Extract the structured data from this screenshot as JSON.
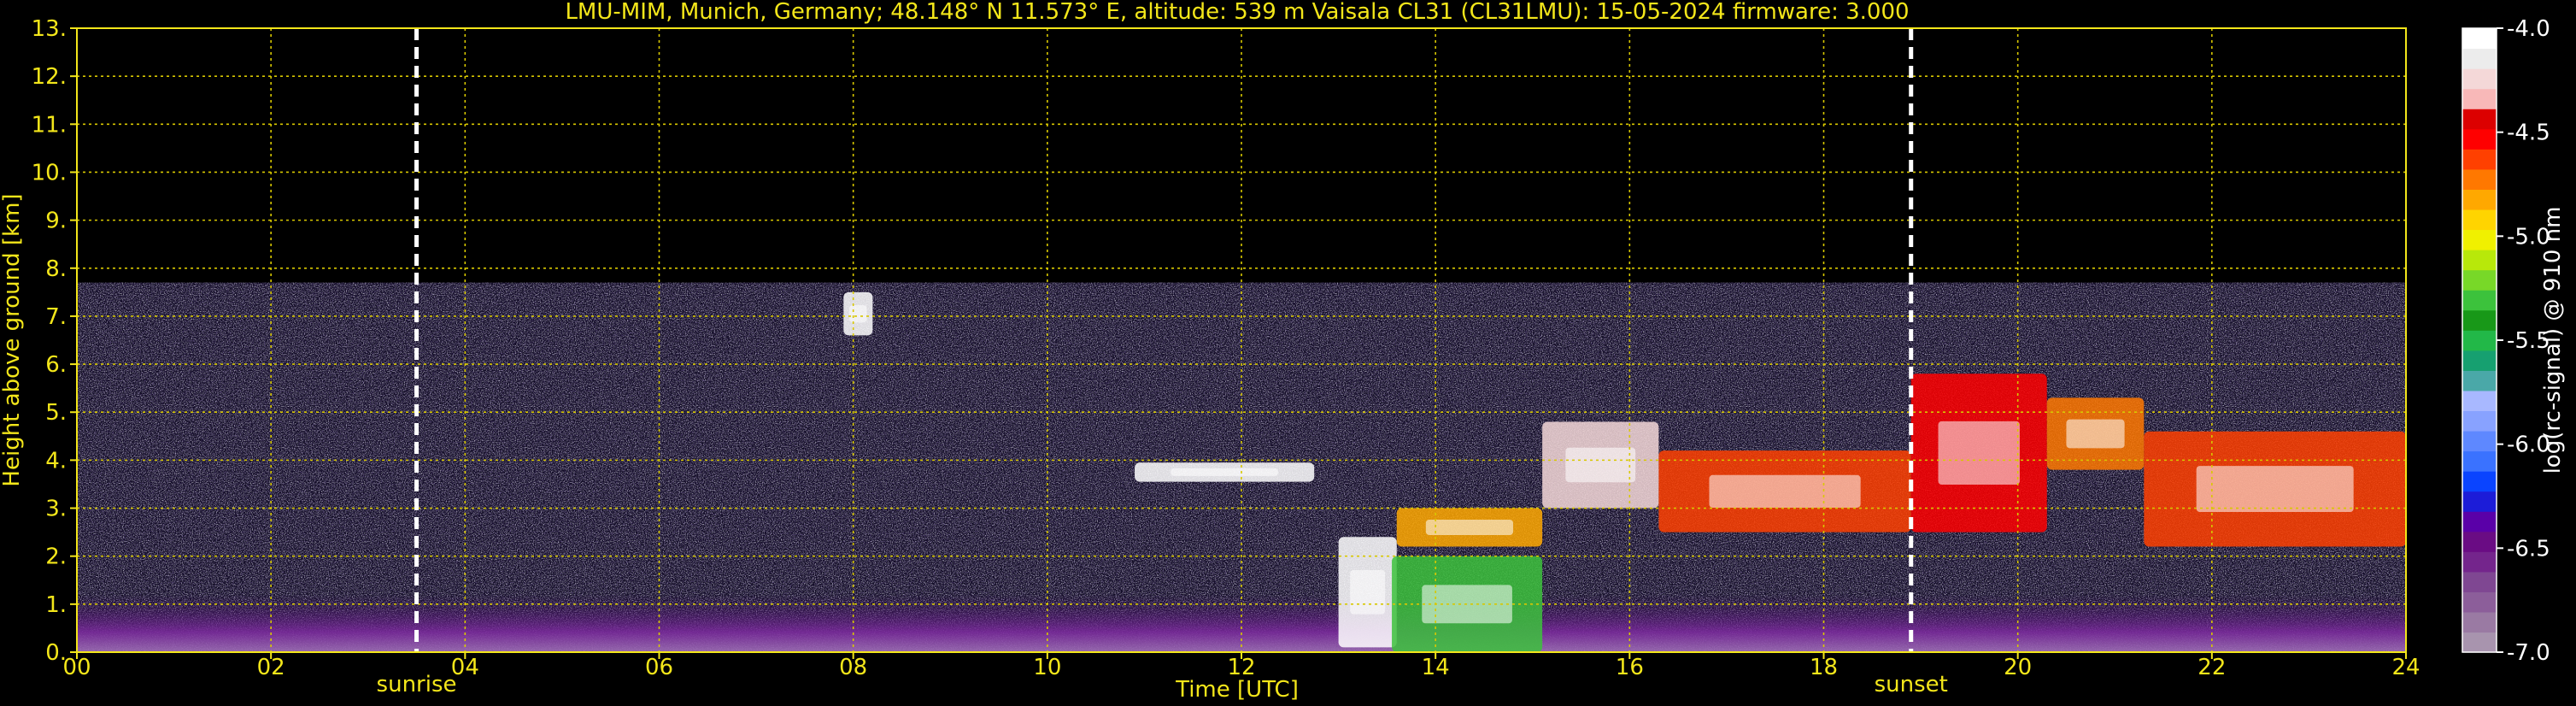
{
  "chart_data": {
    "type": "heatmap",
    "title": "LMU-MIM, Munich, Germany; 48.148° N 11.573° E, altitude: 539 m    Vaisala CL31 (CL31LMU): 15-05-2024    firmware: 3.000",
    "xlabel": "Time [UTC]",
    "ylabel": "Height above ground [km]",
    "xlim": [
      0,
      24
    ],
    "ylim": [
      0,
      13
    ],
    "x_ticks": [
      "00",
      "02",
      "04",
      "06",
      "08",
      "10",
      "12",
      "14",
      "16",
      "18",
      "20",
      "22",
      "24"
    ],
    "y_ticks": [
      "0.",
      "1.",
      "2.",
      "3.",
      "4.",
      "5.",
      "6.",
      "7.",
      "8.",
      "9.",
      "10.",
      "11.",
      "12.",
      "13."
    ],
    "grid": true,
    "events": [
      {
        "label": "sunrise",
        "time": 3.5
      },
      {
        "label": "sunset",
        "time": 18.9
      }
    ],
    "colorbar": {
      "label": "log(rc-signal) @ 910 nm",
      "range": [
        -7.0,
        -4.0
      ],
      "ticks": [
        "-4.0",
        "-4.5",
        "-5.0",
        "-5.5",
        "-6.0",
        "-6.5",
        "-7.0"
      ],
      "colors": [
        "#a894ae",
        "#9a7aa3",
        "#8c5e9a",
        "#7f4792",
        "#74258c",
        "#6a0c84",
        "#5a00a8",
        "#1c1cd8",
        "#0a44ff",
        "#3a72ff",
        "#5e88ff",
        "#88a2ff",
        "#a8b8ff",
        "#4aa8a8",
        "#16a070",
        "#22b848",
        "#189818",
        "#3cc23c",
        "#78d828",
        "#b8e80a",
        "#f0f000",
        "#ffd400",
        "#ffa800",
        "#ff7800",
        "#ff4000",
        "#ff0000",
        "#dc0000",
        "#f8b8b8",
        "#f4d8d8",
        "#ececec",
        "#ffffff"
      ]
    },
    "data_ceiling_km": 7.7,
    "cloud_layers": [
      {
        "t0": 10.9,
        "t1": 12.75,
        "h0": 3.55,
        "h1": 3.95,
        "level": "-4.0"
      },
      {
        "t0": 7.9,
        "t1": 8.2,
        "h0": 6.6,
        "h1": 7.5,
        "level": "-4.0"
      },
      {
        "t0": 13.0,
        "t1": 13.6,
        "h0": 0.1,
        "h1": 2.4,
        "level": "-4.0"
      },
      {
        "t0": 13.55,
        "t1": 15.1,
        "h0": 0.0,
        "h1": 2.0,
        "level": "-5.3"
      },
      {
        "t0": 13.6,
        "t1": 15.1,
        "h0": 2.2,
        "h1": 3.0,
        "level": "-4.8"
      },
      {
        "t0": 15.1,
        "t1": 16.3,
        "h0": 3.0,
        "h1": 4.8,
        "level": "-4.2"
      },
      {
        "t0": 16.3,
        "t1": 18.9,
        "h0": 2.5,
        "h1": 4.2,
        "level": "-4.6"
      },
      {
        "t0": 18.9,
        "t1": 20.3,
        "h0": 2.5,
        "h1": 5.8,
        "level": "-4.5"
      },
      {
        "t0": 20.3,
        "t1": 21.3,
        "h0": 3.8,
        "h1": 5.3,
        "level": "-4.7"
      },
      {
        "t0": 21.3,
        "t1": 24.0,
        "h0": 2.2,
        "h1": 4.6,
        "level": "-4.6"
      }
    ],
    "boundary_layer": {
      "top_km": 1.2,
      "level": "-6.5"
    }
  }
}
